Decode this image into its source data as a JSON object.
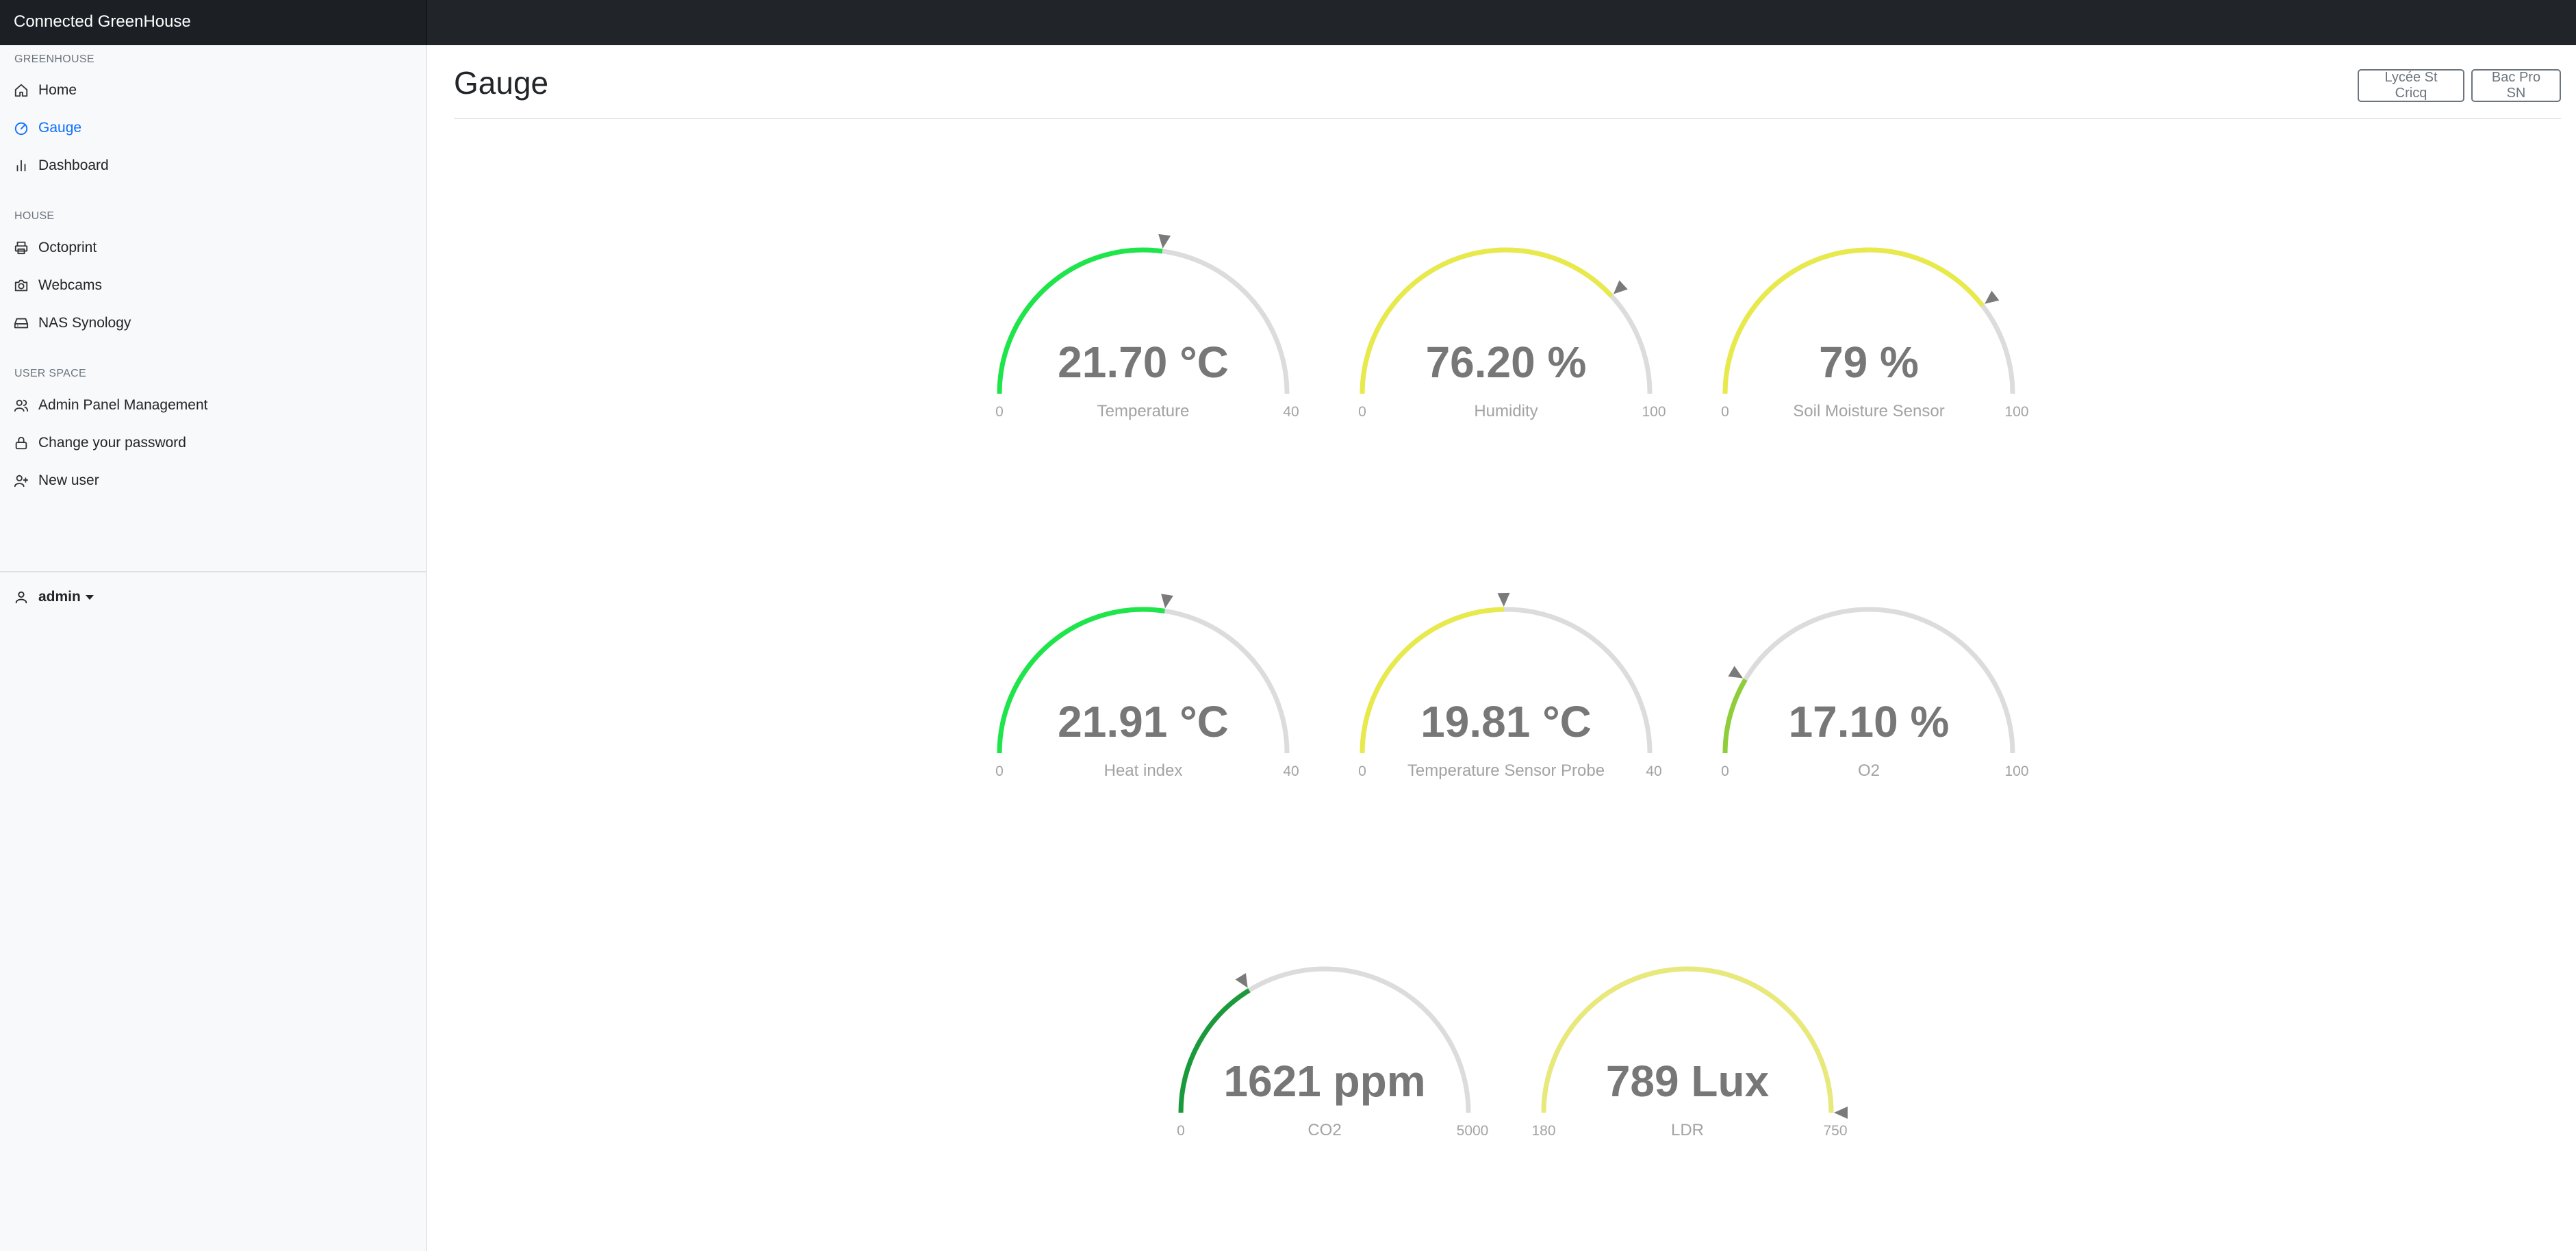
{
  "app": {
    "title": "Connected GreenHouse"
  },
  "sidebar": {
    "sections": [
      {
        "heading": "GREENHOUSE",
        "items": [
          {
            "label": "Home",
            "icon": "home-icon"
          },
          {
            "label": "Gauge",
            "icon": "gauge-icon",
            "active": true
          },
          {
            "label": "Dashboard",
            "icon": "bar-chart-icon"
          }
        ]
      },
      {
        "heading": "HOUSE",
        "items": [
          {
            "label": "Octoprint",
            "icon": "printer-icon"
          },
          {
            "label": "Webcams",
            "icon": "camera-icon"
          },
          {
            "label": "NAS Synology",
            "icon": "storage-icon"
          }
        ]
      },
      {
        "heading": "USER SPACE",
        "items": [
          {
            "label": "Admin Panel Management",
            "icon": "users-icon"
          },
          {
            "label": "Change your password",
            "icon": "lock-icon"
          },
          {
            "label": "New user",
            "icon": "user-plus-icon"
          }
        ]
      }
    ],
    "user": {
      "name": "admin",
      "icon": "user-icon"
    }
  },
  "main": {
    "title": "Gauge",
    "buttons": [
      "Lycée St Cricq",
      "Bac Pro SN"
    ]
  },
  "colors": {
    "accent": "#0d6efd",
    "track": "#dcdcdc",
    "green": "#1ee54a",
    "yellow": "#e7ea4a",
    "yellow_green": "#8fcd3a",
    "dark_green": "#1a9a3a",
    "pale_yellow": "#e8e97a",
    "value_text": "#777777",
    "label_text": "#a3a3a3"
  },
  "gauges": [
    {
      "value": "21.70 °C",
      "label": "Temperature",
      "min": "0",
      "max": "40",
      "level": 0.5425,
      "color": "#1ee54a"
    },
    {
      "value": "76.20 %",
      "label": "Humidity",
      "min": "0",
      "max": "100",
      "level": 0.762,
      "color": "#e7ea4a"
    },
    {
      "value": "79 %",
      "label": "Soil Moisture Sensor",
      "min": "0",
      "max": "100",
      "level": 0.79,
      "color": "#e7ea4a"
    },
    {
      "value": "21.91 °C",
      "label": "Heat index",
      "min": "0",
      "max": "40",
      "level": 0.5478,
      "color": "#1ee54a"
    },
    {
      "value": "19.81 °C",
      "label": "Temperature Sensor Probe",
      "min": "0",
      "max": "40",
      "level": 0.4953,
      "color": "#e7ea4a"
    },
    {
      "value": "17.10 %",
      "label": "O2",
      "min": "0",
      "max": "100",
      "level": 0.171,
      "color": "#8fcd3a"
    },
    {
      "value": "1621 ppm",
      "label": "CO2",
      "min": "0",
      "max": "5000",
      "level": 0.3242,
      "color": "#1a9a3a"
    },
    {
      "value": "789 Lux",
      "label": "LDR",
      "min": "180",
      "max": "750",
      "level": 1.0,
      "color": "#e8e97a"
    }
  ]
}
